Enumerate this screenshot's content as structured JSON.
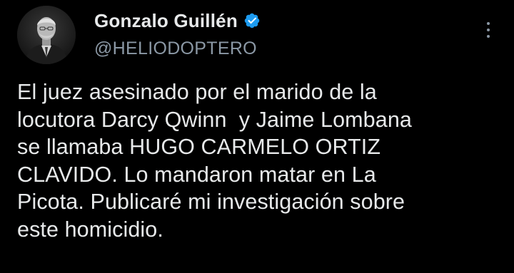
{
  "author": {
    "display_name": "Gonzalo Guillén",
    "handle": "@HELIODOPTERO",
    "verified": true,
    "avatar_icon": "profile-photo"
  },
  "menu": {
    "more_icon": "more-vertical-icon"
  },
  "tweet": {
    "lines": [
      "El juez asesinado por el marido de la",
      "locutora Darcy Qwinn  y Jaime Lombana",
      "se llamaba HUGO CARMELO ORTIZ",
      "CLAVIDO. Lo mandaron matar en La",
      "Picota. Publicaré mi investigación sobre",
      "este homicidio."
    ]
  },
  "colors": {
    "background": "#000000",
    "text_primary": "#e7e9ea",
    "text_secondary": "#8b98a5",
    "verified_blue": "#1d9bf0"
  }
}
